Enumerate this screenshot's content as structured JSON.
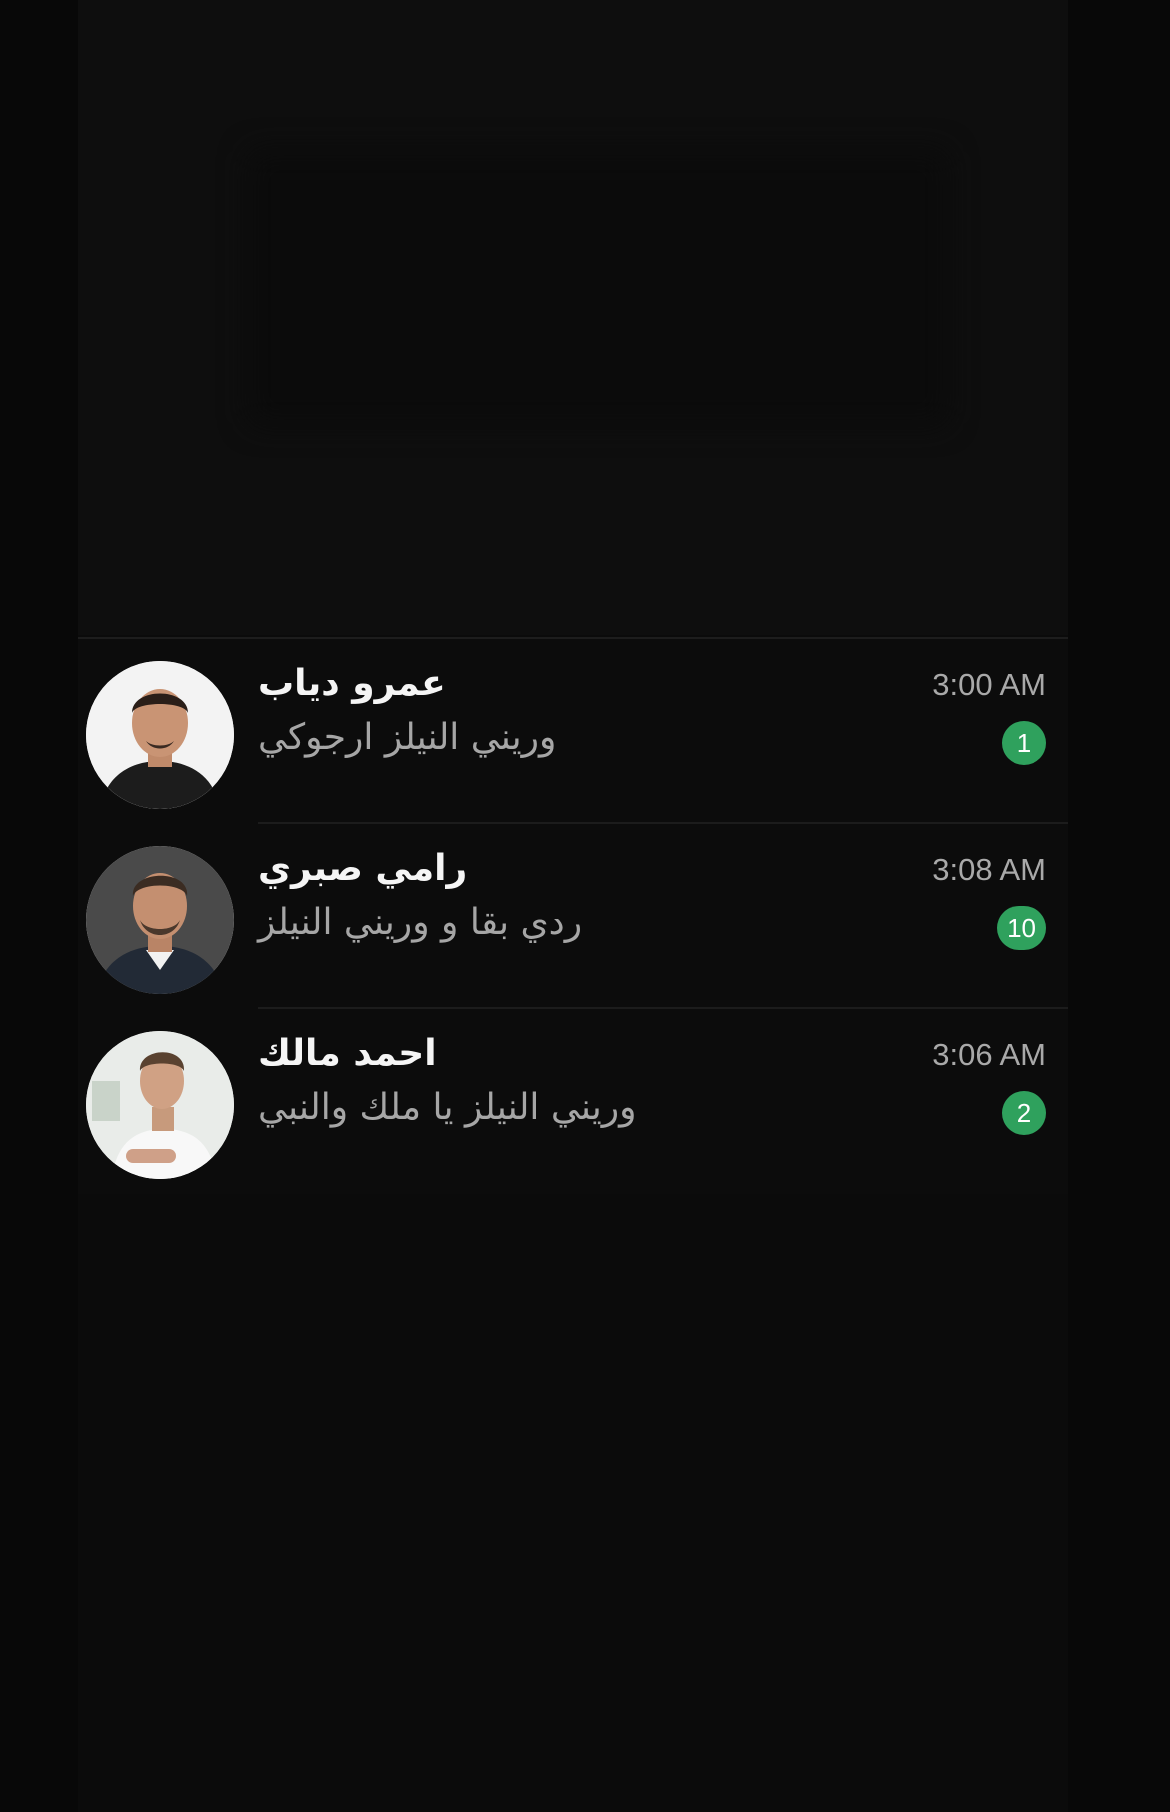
{
  "chats": [
    {
      "name": "عمرو دياب",
      "preview": "وريني النيلز ارجوكي",
      "time": "3:00 AM",
      "unread": "1",
      "avatar": "contact-avatar-photo"
    },
    {
      "name": "رامي صبري",
      "preview": "ردي بقا و وريني النيلز",
      "time": "3:08 AM",
      "unread": "10",
      "avatar": "contact-avatar-photo"
    },
    {
      "name": "احمد مالك",
      "preview": "وريني النيلز يا ملك والنبي",
      "time": "3:06 AM",
      "unread": "2",
      "avatar": "contact-avatar-photo"
    }
  ],
  "colors": {
    "background": "#0b0b0b",
    "badge": "#2fa15d",
    "name_text": "#f5f5f5",
    "preview_text": "#a6a6a6"
  }
}
